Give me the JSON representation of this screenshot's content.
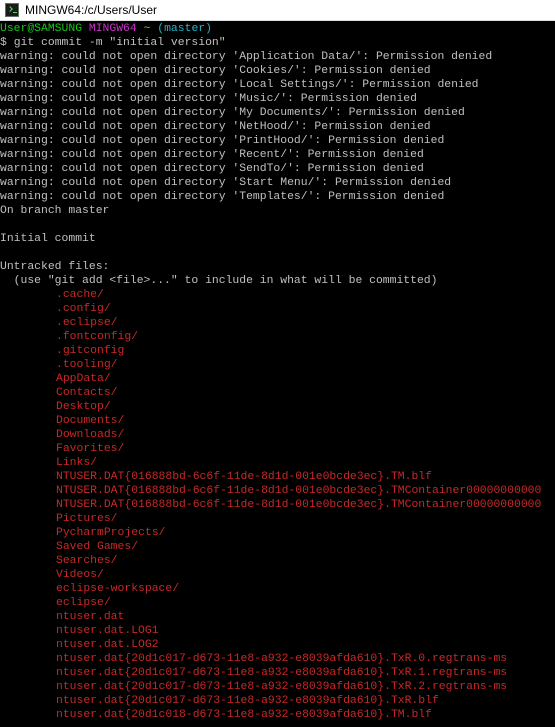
{
  "window": {
    "title": "MINGW64:/c/Users/User"
  },
  "prompt": {
    "user_host": "User@SAMSUNG",
    "env": "MINGW64",
    "path": "~",
    "branch": "(master)",
    "symbol": "$",
    "command": "git commit -m \"initial version\""
  },
  "warnings": [
    "warning: could not open directory 'Application Data/': Permission denied",
    "warning: could not open directory 'Cookies/': Permission denied",
    "warning: could not open directory 'Local Settings/': Permission denied",
    "warning: could not open directory 'Music/': Permission denied",
    "warning: could not open directory 'My Documents/': Permission denied",
    "warning: could not open directory 'NetHood/': Permission denied",
    "warning: could not open directory 'PrintHood/': Permission denied",
    "warning: could not open directory 'Recent/': Permission denied",
    "warning: could not open directory 'SendTo/': Permission denied",
    "warning: could not open directory 'Start Menu/': Permission denied",
    "warning: could not open directory 'Templates/': Permission denied"
  ],
  "status": {
    "branch_line": "On branch master",
    "initial_commit": "Initial commit",
    "untracked_header": "Untracked files:",
    "hint": "  (use \"git add <file>...\" to include in what will be committed)"
  },
  "untracked_files": [
    ".cache/",
    ".config/",
    ".eclipse/",
    ".fontconfig/",
    ".gitconfig",
    ".tooling/",
    "AppData/",
    "Contacts/",
    "Desktop/",
    "Documents/",
    "Downloads/",
    "Favorites/",
    "Links/",
    "NTUSER.DAT{016888bd-6c6f-11de-8d1d-001e0bcde3ec}.TM.blf",
    "NTUSER.DAT{016888bd-6c6f-11de-8d1d-001e0bcde3ec}.TMContainer00000000000",
    "NTUSER.DAT{016888bd-6c6f-11de-8d1d-001e0bcde3ec}.TMContainer00000000000",
    "Pictures/",
    "PycharmProjects/",
    "Saved Games/",
    "Searches/",
    "Videos/",
    "eclipse-workspace/",
    "eclipse/",
    "ntuser.dat",
    "ntuser.dat.LOG1",
    "ntuser.dat.LOG2",
    "ntuser.dat{20d1c017-d673-11e8-a932-e8039afda610}.TxR.0.regtrans-ms",
    "ntuser.dat{20d1c017-d673-11e8-a932-e8039afda610}.TxR.1.regtrans-ms",
    "ntuser.dat{20d1c017-d673-11e8-a932-e8039afda610}.TxR.2.regtrans-ms",
    "ntuser.dat{20d1c017-d673-11e8-a932-e8039afda610}.TxR.blf",
    "ntuser.dat{20d1c018-d673-11e8-a932-e8039afda610}.TM.blf"
  ],
  "colors": {
    "background": "#000000",
    "text": "#c0c0c0",
    "user_host": "#14c814",
    "env": "#c832c8",
    "path": "#c8b400",
    "branch": "#22b4c8",
    "untracked": "#c82828"
  },
  "icons": {
    "app": "git-bash-terminal-icon"
  }
}
